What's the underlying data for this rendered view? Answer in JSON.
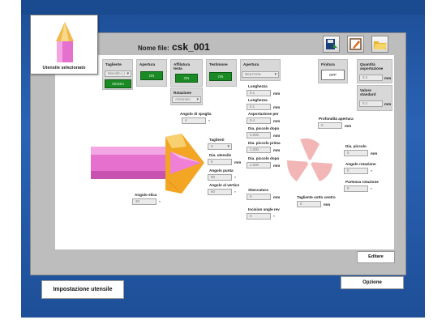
{
  "header": {
    "file_label": "Nome file:",
    "file_name": "csk_001"
  },
  "thumbnail": {
    "label": "Utensile selezionato"
  },
  "toolbar": [
    "save-icon",
    "edit-icon",
    "open-folder-icon"
  ],
  "groups": {
    "tagliente": {
      "label": "Tagliente",
      "value": "Monotlo ( ) →",
      "button": "Sinistro"
    },
    "apertura_top": {
      "label": "Apertura",
      "button": "ON"
    },
    "affilatura": {
      "label": "Affilatura testa",
      "button": "ON"
    },
    "testimone": {
      "label": "Testimone",
      "button": "ON"
    },
    "apertura_select": {
      "label": "Apertura",
      "value": "Nea Forta"
    },
    "rotazione": {
      "label": "Rotazione",
      "value": "Antiorario"
    },
    "finitura": {
      "label": "Finitura",
      "button": "OFF"
    },
    "quantita": {
      "label": "Quantità asportazione",
      "value": "0.2",
      "unit": "mm"
    },
    "valore": {
      "label": "Valore standard",
      "value": "0.2",
      "unit": "mm"
    }
  },
  "fields": {
    "lunghezza1": {
      "label": "Lunghezza",
      "value": "0.1",
      "unit": "mm"
    },
    "lunghezza2": {
      "label": "Lunghezza",
      "value": "0.1",
      "unit": "mm"
    },
    "asportazione": {
      "label": "Asportazione per",
      "value": "0.4",
      "unit": "mm"
    },
    "dia_piccolo_dopo": {
      "label": "Dia. piccolo dopo",
      "value": "0.000",
      "unit": "mm"
    },
    "dia_piccolo_prima": {
      "label": "Dia. piccolo prima",
      "value": "1.000",
      "unit": "mm"
    },
    "dia_piccolo_dopo2": {
      "label": "Dia. piccolo dopo",
      "value": "1.000",
      "unit": "mm"
    },
    "angolo_spoglia": {
      "label": "Angolo di spoglia",
      "value": "4",
      "unit": "°"
    },
    "taglienti": {
      "label": "Taglienti",
      "value": "3"
    },
    "dia_utensile": {
      "label": "Dia. utensile",
      "value": "6",
      "unit": "mm"
    },
    "angolo_punta": {
      "label": "Angolo punta",
      "value": "90",
      "unit": "°"
    },
    "angolo_vertice": {
      "label": "Angolo al vertice",
      "value": "90",
      "unit": "°"
    },
    "angolo_elica": {
      "label": "Angolo elica",
      "value": "30",
      "unit": "°"
    },
    "sbeccatura": {
      "label": "Sbeccatura",
      "value": "0",
      "unit": "mm"
    },
    "incision_angle": {
      "label": "Incision angle rev",
      "value": "0",
      "unit": "°"
    },
    "profondita": {
      "label": "Profondità apertura",
      "value": "0",
      "unit": "mm"
    },
    "taglio_centro": {
      "label": "Tagliente sotto centro",
      "value": "0",
      "unit": "mm"
    },
    "dia_piccolo": {
      "label": "Dia. piccolo",
      "value": "0",
      "unit": "mm"
    },
    "angolo_rotazione": {
      "label": "Angolo rotazione",
      "value": "0",
      "unit": "°"
    },
    "partenza_rotazione": {
      "label": "Partenza rotazione",
      "value": "0",
      "unit": "°"
    }
  },
  "buttons": {
    "editare": "Editare",
    "opzione": "Opzione",
    "impostazione": "Impostazione utensile"
  },
  "colors": {
    "frame": "#2a63b5",
    "green": "#1a8a24",
    "tool_pink": "#e86fd0",
    "tool_gold": "#f2a623",
    "blade": "#f3b6b6"
  }
}
